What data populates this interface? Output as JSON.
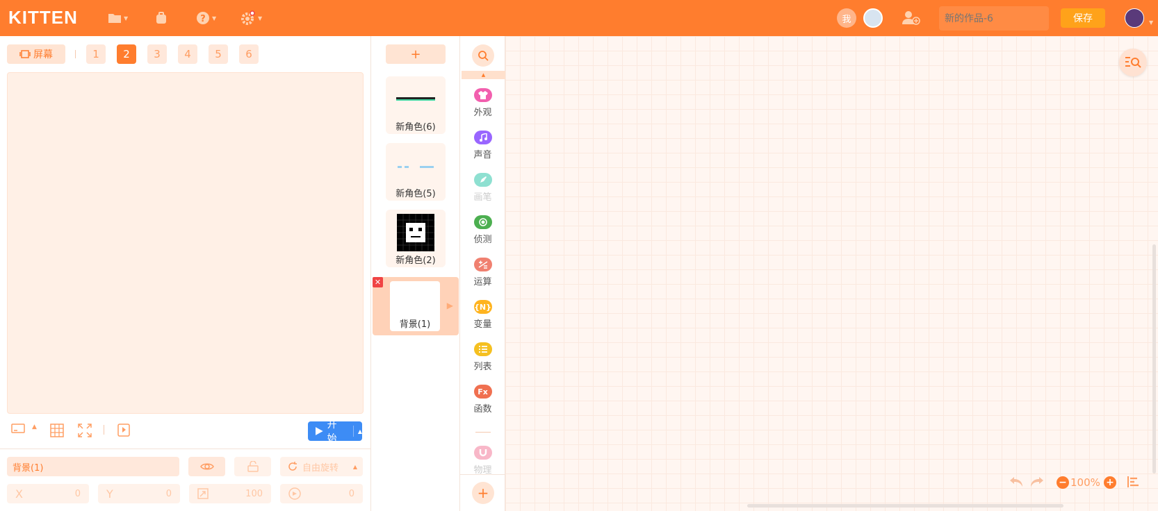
{
  "app": {
    "logo": "KITTEN",
    "title_placeholder": "新的作品-6",
    "save_label": "保存",
    "me_badge": "我"
  },
  "stage": {
    "screen_label": "屏幕",
    "screens": [
      "1",
      "2",
      "3",
      "4",
      "5",
      "6"
    ],
    "active_screen": "2",
    "start_label": "开始"
  },
  "properties": {
    "name": "背景(1)",
    "rotation_label": "自由旋转",
    "x_label": "X",
    "x_value": "0",
    "y_label": "Y",
    "y_value": "0",
    "size_value": "100",
    "direction_value": "0"
  },
  "sprites": {
    "add_label": "+",
    "items": [
      {
        "label": "新角色(6)"
      },
      {
        "label": "新角色(5)"
      },
      {
        "label": "新角色(2)"
      }
    ],
    "background": {
      "label": "背景(1)"
    }
  },
  "categories": [
    {
      "label": "外观",
      "color": "#f25fae",
      "icon": "shirt-icon",
      "disabled": false
    },
    {
      "label": "声音",
      "color": "#9966ff",
      "icon": "music-icon",
      "disabled": false
    },
    {
      "label": "画笔",
      "color": "#8ee0d1",
      "icon": "pen-icon",
      "disabled": true
    },
    {
      "label": "侦测",
      "color": "#4caf50",
      "icon": "sensor-icon",
      "disabled": false
    },
    {
      "label": "运算",
      "color": "#f08070",
      "icon": "operator-icon",
      "disabled": false
    },
    {
      "label": "变量",
      "color": "#ffb420",
      "icon": "variable-icon",
      "disabled": false
    },
    {
      "label": "列表",
      "color": "#f5c020",
      "icon": "list-icon",
      "disabled": false
    },
    {
      "label": "函数",
      "color": "#f07050",
      "icon": "function-icon",
      "disabled": false
    },
    {
      "label": "物理",
      "color": "#f8b7c8",
      "icon": "magnet-icon",
      "disabled": true
    }
  ],
  "category_badges": {
    "variable": "{N}",
    "function": "Fx"
  },
  "workspace": {
    "zoom": "100%"
  }
}
